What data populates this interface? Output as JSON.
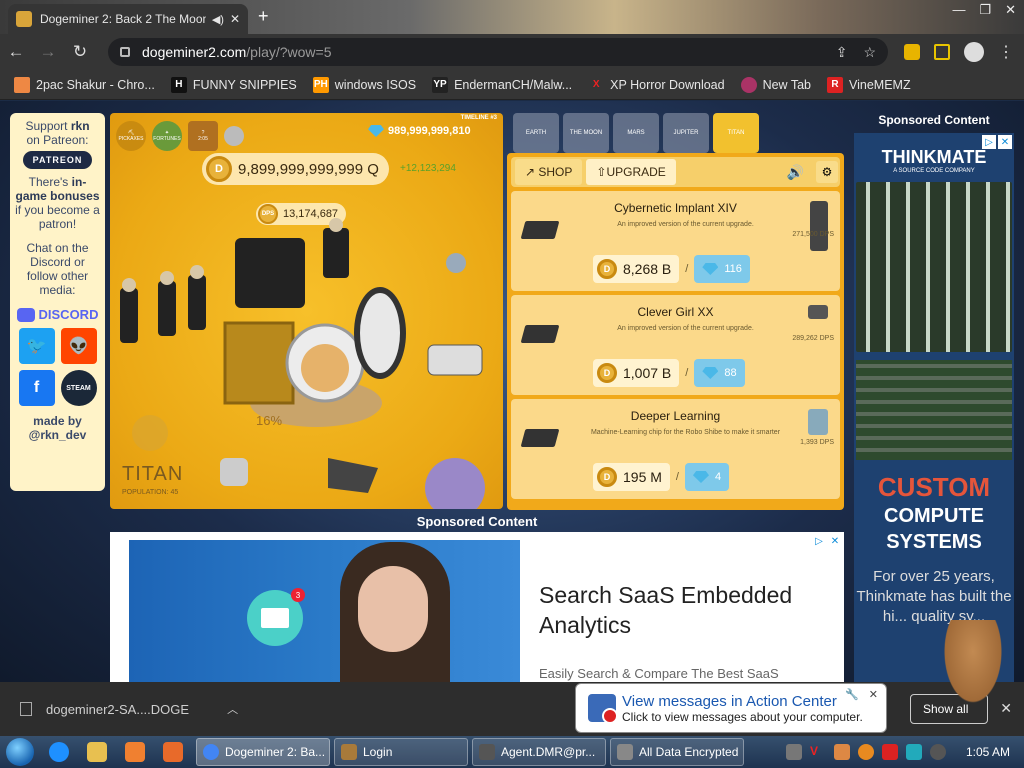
{
  "browser": {
    "tab_title": "Dogeminer 2: Back 2 The Moon",
    "url_host": "dogeminer2.com",
    "url_path": "/play/?wow=5",
    "bookmarks": [
      {
        "label": "2pac Shakur - Chro...",
        "icon_text": "",
        "color": "#e84"
      },
      {
        "label": "FUNNY SNIPPIES",
        "icon_text": "H",
        "color": "#111"
      },
      {
        "label": "windows ISOS",
        "icon_text": "PH",
        "color": "#f90"
      },
      {
        "label": "EndermanCH/Malw...",
        "icon_text": "YP",
        "color": "#222"
      },
      {
        "label": "XP Horror Download",
        "icon_text": "X",
        "color": "#c00"
      },
      {
        "label": "New Tab",
        "icon_text": "",
        "color": "#a36"
      },
      {
        "label": "VineMEMZ",
        "icon_text": "R",
        "color": "#d22"
      }
    ]
  },
  "left_panel": {
    "support_line1": "Support",
    "support_name": "rkn",
    "support_line2": "on Patreon:",
    "patreon_label": "PATREON",
    "bonus_a": "There's",
    "bonus_b": "in-game bonuses",
    "bonus_c": "if you become a patron!",
    "chat": "Chat on the Discord or follow other media:",
    "discord_label": "DISCORD",
    "made_by": "made by",
    "made_handle": "@rkn_dev"
  },
  "game": {
    "tool_labels": [
      "PICKAXES",
      "FORTUNES",
      "2:05"
    ],
    "gems": "989,999,999,810",
    "timeline": "TIMELINE #3",
    "coins": "9,899,999,999,999 Q",
    "coin_rate": "+12,123,294",
    "dps_badge": "DPS",
    "dps": "13,174,687",
    "progress_pct": "16%",
    "planet_name": "TITAN",
    "population": "POPULATION: 45"
  },
  "planets": [
    "EARTH",
    "THE MOON",
    "MARS",
    "JUPITER",
    "TITAN"
  ],
  "shop": {
    "tab_shop": "SHOP",
    "tab_upgrade": "UPGRADE",
    "upgrades": [
      {
        "name": "Cybernetic Implant XIV",
        "desc": "An improved version of the current upgrade.",
        "dps": "271,500 DPS",
        "cost": "8,268 B",
        "gems": "116"
      },
      {
        "name": "Clever Girl XX",
        "desc": "An improved version of the current upgrade.",
        "dps": "289,262 DPS",
        "cost": "1,007 B",
        "gems": "88"
      },
      {
        "name": "Deeper Learning",
        "desc": "Machine-Learning chip for the Robo Shibe to make it smarter",
        "dps": "1,393 DPS",
        "cost": "195 M",
        "gems": "4"
      }
    ]
  },
  "ad_right": {
    "sponsored": "Sponsored Content",
    "logo": "THINKMATE",
    "logo_sub": "A SOURCE CODE COMPANY",
    "custom": "CUSTOM",
    "compute": "COMPUTE",
    "systems": "SYSTEMS",
    "body": "For over 25 years, Thinkmate has built the hi... quality sy..."
  },
  "ad_bottom": {
    "sponsored": "Sponsored Content",
    "badge": "3",
    "title": "Search SaaS Embedded Analytics",
    "subtitle": "Easily Search & Compare The Best SaaS"
  },
  "download": {
    "filename": "dogeminer2-SA....DOGE"
  },
  "balloon": {
    "title": "View messages in Action Center",
    "subtitle": "Click to view messages about your computer.",
    "show_all": "Show all"
  },
  "taskbar": {
    "tasks": [
      {
        "label": "Dogeminer 2: Ba...",
        "color": "#4285f4"
      },
      {
        "label": "Login",
        "color": "#a87a3a"
      },
      {
        "label": "Agent.DMR@pr...",
        "color": "#555"
      },
      {
        "label": "All Data Encrypted",
        "color": "#888"
      }
    ],
    "clock": "1:05 AM"
  }
}
